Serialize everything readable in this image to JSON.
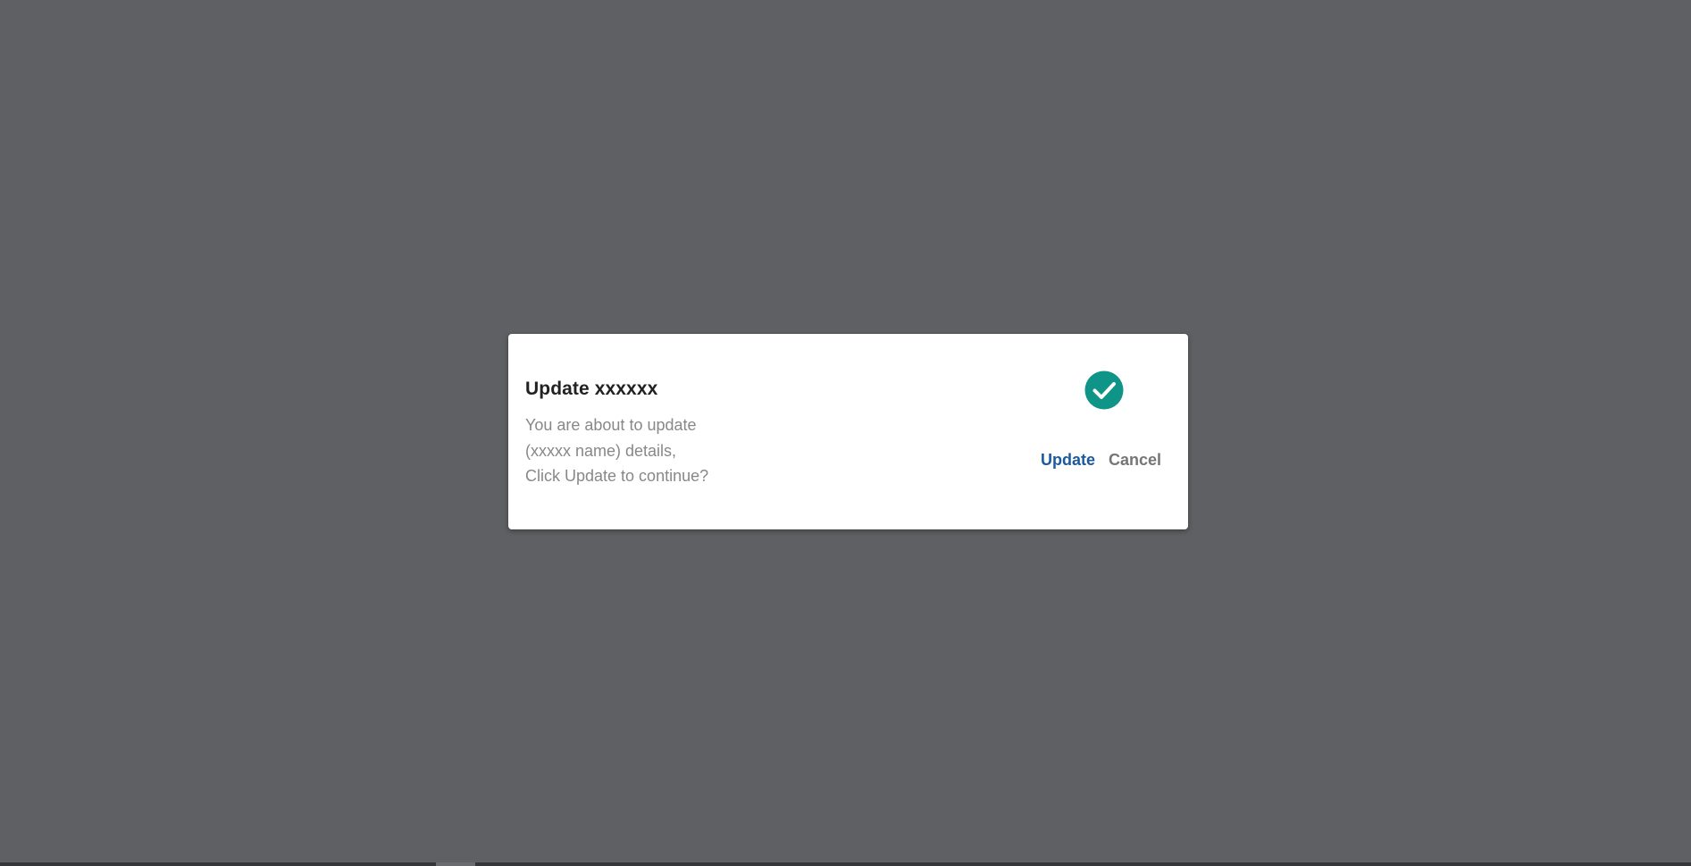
{
  "dialog": {
    "title": "Update xxxxxx",
    "message_lines": [
      "You are about to update",
      "(xxxxx name) details,",
      "Click Update to continue?"
    ],
    "icon": "check-circle-icon",
    "update_label": "Update",
    "cancel_label": "Cancel"
  },
  "colors": {
    "overlay": "#5f6063",
    "icon_accent": "#0f9488",
    "primary_action": "#1b5aa0",
    "secondary_action": "#757575"
  }
}
